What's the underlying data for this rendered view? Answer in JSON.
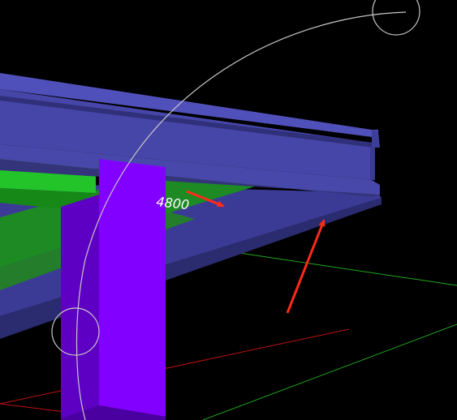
{
  "viewport": {
    "background": "#000000"
  },
  "annotation": {
    "dimension_text": "4800"
  },
  "colors": {
    "beam_top": "#5050bb",
    "beam_face": "#4646a8",
    "beam_bottom": "#34347a",
    "slab": "#3b3b96",
    "green_slab_top": "#22c42a",
    "green_slab_side": "#168818",
    "green_floor": "#1d8a24",
    "column_front": "#8200ff",
    "column_side": "#5e00c4",
    "arrow": "#ff2a1a",
    "grid_green": "#1fa81f",
    "grid_red": "#c01010",
    "orbit": "#c8c8c8"
  },
  "icons": {
    "orbit_ring": "orbit-ring-icon",
    "orbit_handle_top": "orbit-handle-icon",
    "orbit_handle_left": "orbit-handle-icon",
    "arrow_1": "red-arrow-icon",
    "arrow_2": "red-arrow-icon"
  }
}
